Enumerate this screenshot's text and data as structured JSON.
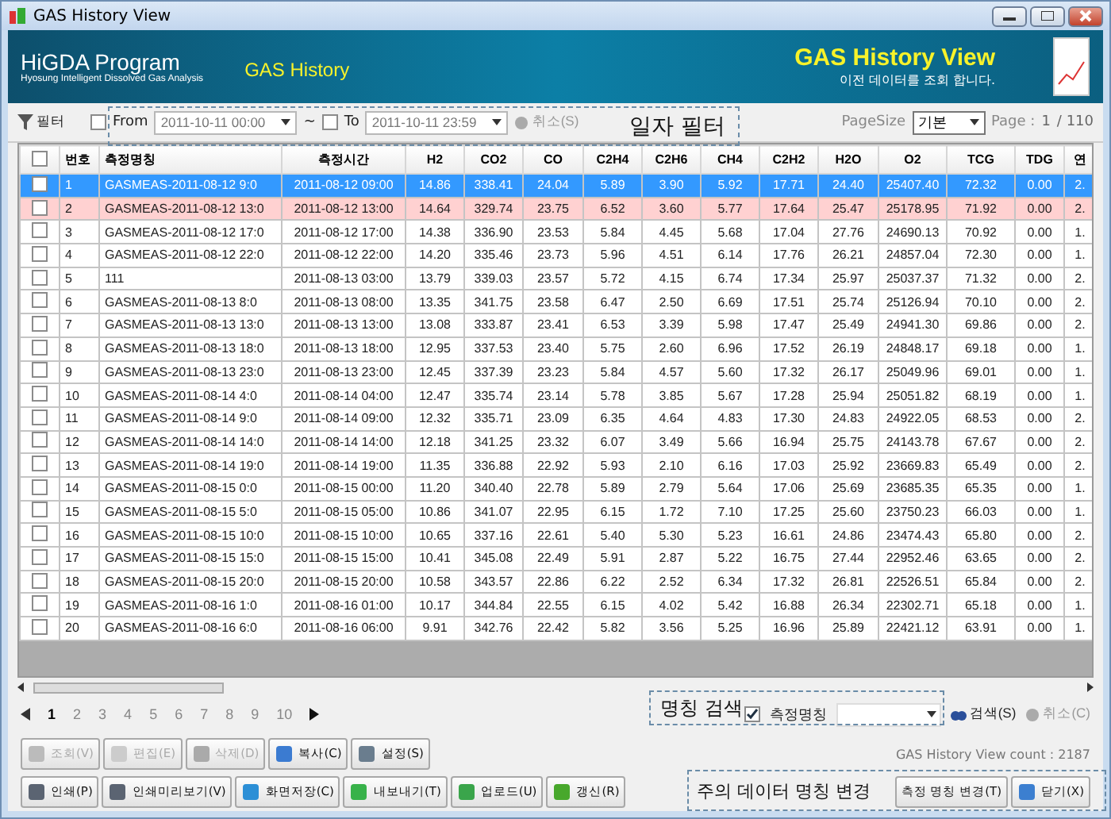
{
  "window": {
    "title": "GAS History View"
  },
  "header": {
    "app_title": "HiGDA Program",
    "app_subtitle": "Hyosung Intelligent Dissolved Gas Analysis",
    "section": "GAS History",
    "view_title": "GAS History View",
    "view_subtitle": "이전 데이터를 조회 합니다."
  },
  "filter": {
    "label": "필터",
    "from": {
      "label": "From",
      "checked": false,
      "value": "2011-10-11 00:00"
    },
    "separator": "~",
    "to": {
      "label": "To",
      "checked": false,
      "value": "2011-10-11 23:59"
    },
    "cancel": "취소(S)",
    "annotation": "일자 필터",
    "page_size_label": "PageSize",
    "page_size": "기본",
    "page_label": "Page :",
    "page": "1",
    "page_total": "/ 110"
  },
  "table": {
    "select_all_checked": false,
    "columns": [
      "번호",
      "측정명칭",
      "측정시간",
      "H2",
      "CO2",
      "CO",
      "C2H4",
      "C2H6",
      "CH4",
      "C2H2",
      "H2O",
      "O2",
      "TCG",
      "TDG",
      "연"
    ],
    "rows": [
      {
        "checked": false,
        "selected": true,
        "flagged": false,
        "cells": [
          "1",
          "GASMEAS-2011-08-12 9:0",
          "2011-08-12 09:00",
          "14.86",
          "338.41",
          "24.04",
          "5.89",
          "3.90",
          "5.92",
          "17.71",
          "24.40",
          "25407.40",
          "72.32",
          "0.00",
          "2."
        ]
      },
      {
        "checked": false,
        "selected": false,
        "flagged": true,
        "cells": [
          "2",
          "GASMEAS-2011-08-12 13:0",
          "2011-08-12 13:00",
          "14.64",
          "329.74",
          "23.75",
          "6.52",
          "3.60",
          "5.77",
          "17.64",
          "25.47",
          "25178.95",
          "71.92",
          "0.00",
          "2."
        ]
      },
      {
        "checked": false,
        "selected": false,
        "flagged": false,
        "cells": [
          "3",
          "GASMEAS-2011-08-12 17:0",
          "2011-08-12 17:00",
          "14.38",
          "336.90",
          "23.53",
          "5.84",
          "4.45",
          "5.68",
          "17.04",
          "27.76",
          "24690.13",
          "70.92",
          "0.00",
          "1."
        ]
      },
      {
        "checked": false,
        "selected": false,
        "flagged": false,
        "cells": [
          "4",
          "GASMEAS-2011-08-12 22:0",
          "2011-08-12 22:00",
          "14.20",
          "335.46",
          "23.73",
          "5.96",
          "4.51",
          "6.14",
          "17.76",
          "26.21",
          "24857.04",
          "72.30",
          "0.00",
          "1."
        ]
      },
      {
        "checked": false,
        "selected": false,
        "flagged": false,
        "cells": [
          "5",
          "111",
          "2011-08-13 03:00",
          "13.79",
          "339.03",
          "23.57",
          "5.72",
          "4.15",
          "6.74",
          "17.34",
          "25.97",
          "25037.37",
          "71.32",
          "0.00",
          "2."
        ]
      },
      {
        "checked": false,
        "selected": false,
        "flagged": false,
        "cells": [
          "6",
          "GASMEAS-2011-08-13 8:0",
          "2011-08-13 08:00",
          "13.35",
          "341.75",
          "23.58",
          "6.47",
          "2.50",
          "6.69",
          "17.51",
          "25.74",
          "25126.94",
          "70.10",
          "0.00",
          "2."
        ]
      },
      {
        "checked": false,
        "selected": false,
        "flagged": false,
        "cells": [
          "7",
          "GASMEAS-2011-08-13 13:0",
          "2011-08-13 13:00",
          "13.08",
          "333.87",
          "23.41",
          "6.53",
          "3.39",
          "5.98",
          "17.47",
          "25.49",
          "24941.30",
          "69.86",
          "0.00",
          "2."
        ]
      },
      {
        "checked": false,
        "selected": false,
        "flagged": false,
        "cells": [
          "8",
          "GASMEAS-2011-08-13 18:0",
          "2011-08-13 18:00",
          "12.95",
          "337.53",
          "23.40",
          "5.75",
          "2.60",
          "6.96",
          "17.52",
          "26.19",
          "24848.17",
          "69.18",
          "0.00",
          "1."
        ]
      },
      {
        "checked": false,
        "selected": false,
        "flagged": false,
        "cells": [
          "9",
          "GASMEAS-2011-08-13 23:0",
          "2011-08-13 23:00",
          "12.45",
          "337.39",
          "23.23",
          "5.84",
          "4.57",
          "5.60",
          "17.32",
          "26.17",
          "25049.96",
          "69.01",
          "0.00",
          "1."
        ]
      },
      {
        "checked": false,
        "selected": false,
        "flagged": false,
        "cells": [
          "10",
          "GASMEAS-2011-08-14 4:0",
          "2011-08-14 04:00",
          "12.47",
          "335.74",
          "23.14",
          "5.78",
          "3.85",
          "5.67",
          "17.28",
          "25.94",
          "25051.82",
          "68.19",
          "0.00",
          "1."
        ]
      },
      {
        "checked": false,
        "selected": false,
        "flagged": false,
        "cells": [
          "11",
          "GASMEAS-2011-08-14 9:0",
          "2011-08-14 09:00",
          "12.32",
          "335.71",
          "23.09",
          "6.35",
          "4.64",
          "4.83",
          "17.30",
          "24.83",
          "24922.05",
          "68.53",
          "0.00",
          "2."
        ]
      },
      {
        "checked": false,
        "selected": false,
        "flagged": false,
        "cells": [
          "12",
          "GASMEAS-2011-08-14 14:0",
          "2011-08-14 14:00",
          "12.18",
          "341.25",
          "23.32",
          "6.07",
          "3.49",
          "5.66",
          "16.94",
          "25.75",
          "24143.78",
          "67.67",
          "0.00",
          "2."
        ]
      },
      {
        "checked": false,
        "selected": false,
        "flagged": false,
        "cells": [
          "13",
          "GASMEAS-2011-08-14 19:0",
          "2011-08-14 19:00",
          "11.35",
          "336.88",
          "22.92",
          "5.93",
          "2.10",
          "6.16",
          "17.03",
          "25.92",
          "23669.83",
          "65.49",
          "0.00",
          "2."
        ]
      },
      {
        "checked": false,
        "selected": false,
        "flagged": false,
        "cells": [
          "14",
          "GASMEAS-2011-08-15 0:0",
          "2011-08-15 00:00",
          "11.20",
          "340.40",
          "22.78",
          "5.89",
          "2.79",
          "5.64",
          "17.06",
          "25.69",
          "23685.35",
          "65.35",
          "0.00",
          "1."
        ]
      },
      {
        "checked": false,
        "selected": false,
        "flagged": false,
        "cells": [
          "15",
          "GASMEAS-2011-08-15 5:0",
          "2011-08-15 05:00",
          "10.86",
          "341.07",
          "22.95",
          "6.15",
          "1.72",
          "7.10",
          "17.25",
          "25.60",
          "23750.23",
          "66.03",
          "0.00",
          "1."
        ]
      },
      {
        "checked": false,
        "selected": false,
        "flagged": false,
        "cells": [
          "16",
          "GASMEAS-2011-08-15 10:0",
          "2011-08-15 10:00",
          "10.65",
          "337.16",
          "22.61",
          "5.40",
          "5.30",
          "5.23",
          "16.61",
          "24.86",
          "23474.43",
          "65.80",
          "0.00",
          "2."
        ]
      },
      {
        "checked": false,
        "selected": false,
        "flagged": false,
        "cells": [
          "17",
          "GASMEAS-2011-08-15 15:0",
          "2011-08-15 15:00",
          "10.41",
          "345.08",
          "22.49",
          "5.91",
          "2.87",
          "5.22",
          "16.75",
          "27.44",
          "22952.46",
          "63.65",
          "0.00",
          "2."
        ]
      },
      {
        "checked": false,
        "selected": false,
        "flagged": false,
        "cells": [
          "18",
          "GASMEAS-2011-08-15 20:0",
          "2011-08-15 20:00",
          "10.58",
          "343.57",
          "22.86",
          "6.22",
          "2.52",
          "6.34",
          "17.32",
          "26.81",
          "22526.51",
          "65.84",
          "0.00",
          "2."
        ]
      },
      {
        "checked": false,
        "selected": false,
        "flagged": false,
        "cells": [
          "19",
          "GASMEAS-2011-08-16 1:0",
          "2011-08-16 01:00",
          "10.17",
          "344.84",
          "22.55",
          "6.15",
          "4.02",
          "5.42",
          "16.88",
          "26.34",
          "22302.71",
          "65.18",
          "0.00",
          "1."
        ]
      },
      {
        "checked": false,
        "selected": false,
        "flagged": false,
        "cells": [
          "20",
          "GASMEAS-2011-08-16 6:0",
          "2011-08-16 06:00",
          "9.91",
          "342.76",
          "22.42",
          "5.82",
          "3.56",
          "5.25",
          "16.96",
          "25.89",
          "22421.12",
          "63.91",
          "0.00",
          "1."
        ]
      }
    ]
  },
  "pagination": {
    "pages": [
      {
        "label": "1",
        "selected": true
      },
      {
        "label": "2",
        "selected": false
      },
      {
        "label": "3",
        "selected": false
      },
      {
        "label": "4",
        "selected": false
      },
      {
        "label": "5",
        "selected": false
      },
      {
        "label": "6",
        "selected": false
      },
      {
        "label": "7",
        "selected": false
      },
      {
        "label": "8",
        "selected": false
      },
      {
        "label": "9",
        "selected": false
      },
      {
        "label": "10",
        "selected": false
      }
    ]
  },
  "search": {
    "annotation": "명칭 검색",
    "field_label": "측정명칭",
    "field_checked": true,
    "search": "검색(S)",
    "cancel": "취소(C)"
  },
  "actions": [
    {
      "label": "조회(V)",
      "disabled": true
    },
    {
      "label": "편집(E)",
      "disabled": true
    },
    {
      "label": "삭제(D)",
      "disabled": true
    },
    {
      "label": "복사(C)",
      "disabled": false
    },
    {
      "label": "설정(S)",
      "disabled": false
    }
  ],
  "count": "GAS History View count : 2187",
  "bottom_buttons": [
    {
      "label": "인쇄(P)"
    },
    {
      "label": "인쇄미리보기(V)"
    },
    {
      "label": "화면저장(C)"
    },
    {
      "label": "내보내기(T)"
    },
    {
      "label": "업로드(U)"
    },
    {
      "label": "갱신(R)"
    }
  ],
  "rename": {
    "annotation": "주의 데이터 명칭 변경",
    "button": "측정 명칭 변경(T)",
    "close": "닫기(X)"
  }
}
